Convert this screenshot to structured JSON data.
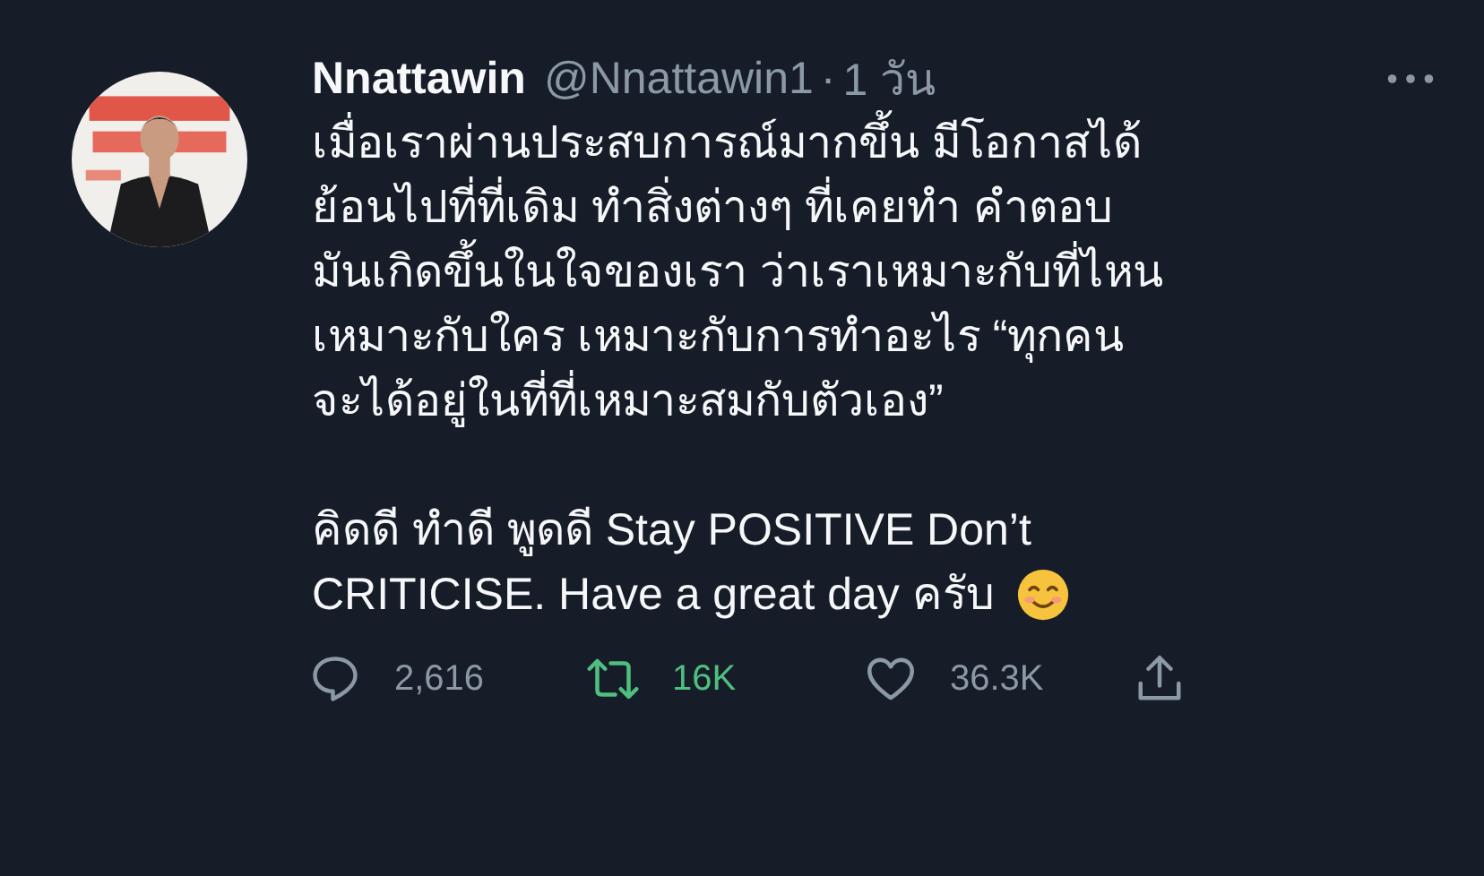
{
  "tweet": {
    "display_name": "Nnattawin",
    "handle": "@Nnattawin1",
    "separator": "·",
    "time": "1 วัน",
    "paragraphs": [
      [
        "เมื่อเราผ่านประสบการณ์มากขึ้น มีโอกาสได้",
        "ย้อนไปที่ที่เดิม ทำสิ่งต่างๆ ที่เคยทำ คำตอบ",
        "มันเกิดขึ้นในใจของเรา ว่าเราเหมาะกับที่ไหน",
        "เหมาะกับใคร เหมาะกับการทำอะไร “ทุกคน",
        "จะได้อยู่ในที่ที่เหมาะสมกับตัวเอง”"
      ],
      [
        "คิดดี ทำดี พูดดี Stay POSITIVE Don’t",
        "CRITICISE. Have a great day ครับ"
      ]
    ],
    "actions": [
      {
        "kind": "reply",
        "count": "2,616",
        "active": false
      },
      {
        "kind": "retweet",
        "count": "16K",
        "active": true
      },
      {
        "kind": "like",
        "count": "36.3K",
        "active": false
      },
      {
        "kind": "share",
        "active": false
      }
    ]
  }
}
